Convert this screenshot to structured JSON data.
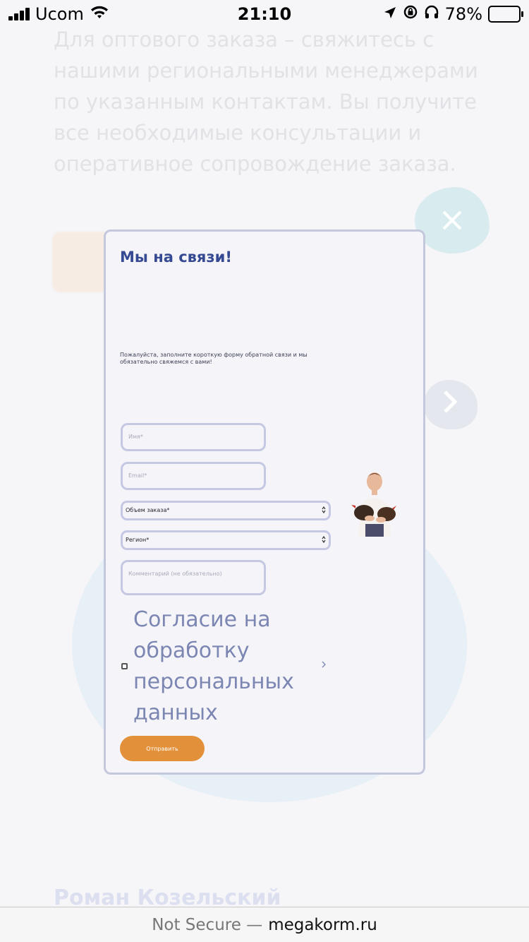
{
  "status_bar": {
    "carrier": "Ucom",
    "time": "21:10",
    "battery": "78%"
  },
  "background": {
    "text": "Для оптового заказа – свяжитесь с нашими региональными менеджерами по указанным контактам. Вы получите все необходимые консультации и оперативное сопровождение заказа.",
    "author_name": "Роман Козельский"
  },
  "modal": {
    "title": "Мы на связи!",
    "description": "Пожалуйста, заполните короткую форму обратной связи и мы обязательно свяжемся с вами!",
    "name_placeholder": "Имя*",
    "email_placeholder": "Email*",
    "volume_select": "Объем заказа*",
    "region_select": "Регион*",
    "comment_placeholder": "Комментарий (не обязательно)",
    "consent_text": "Согласие на обработку персональных данных",
    "submit_label": "Отправить"
  },
  "url_bar": {
    "security": "Not Secure —",
    "domain": "megakorm.ru"
  },
  "colors": {
    "accent": "#e2903a",
    "title": "#354a92",
    "field_border": "#c4c8e3"
  }
}
